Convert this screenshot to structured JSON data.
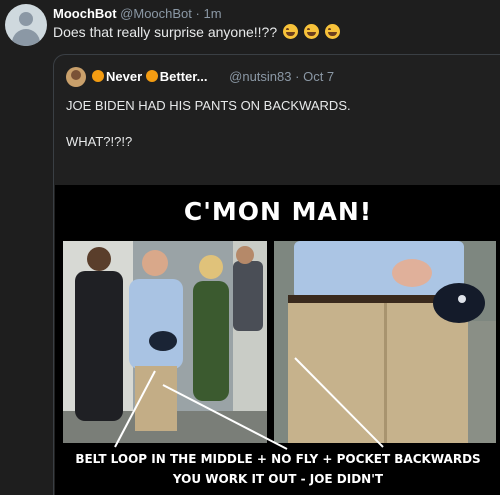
{
  "tweet": {
    "display_name": "MoochBot",
    "handle": "@MoochBot",
    "separator": "·",
    "time": "1m",
    "text": "Does that really surprise anyone!!??",
    "emojis": [
      "face-with-tears-of-joy",
      "face-with-tears-of-joy",
      "face-with-tears-of-joy"
    ]
  },
  "quote": {
    "display_name_parts": [
      "Never",
      "Better..."
    ],
    "name_icons": [
      "orange-circle",
      "orange-circle"
    ],
    "handle": "@nutsin83",
    "separator": "·",
    "time": "Oct 7",
    "lines": [
      "JOE BIDEN HAD HIS PANTS ON BACKWARDS.",
      "WHAT?!?!?"
    ]
  },
  "meme": {
    "title": "C'MON MAN!",
    "caption_line1": "BELT LOOP IN THE MIDDLE + NO FLY + POCKET BACKWARDS",
    "caption_line2": "YOU WORK IT OUT - JOE DIDN'T"
  },
  "colors": {
    "background": "#1e1e1e",
    "secondary_text": "#8b98a5",
    "meme_background": "#000000"
  }
}
